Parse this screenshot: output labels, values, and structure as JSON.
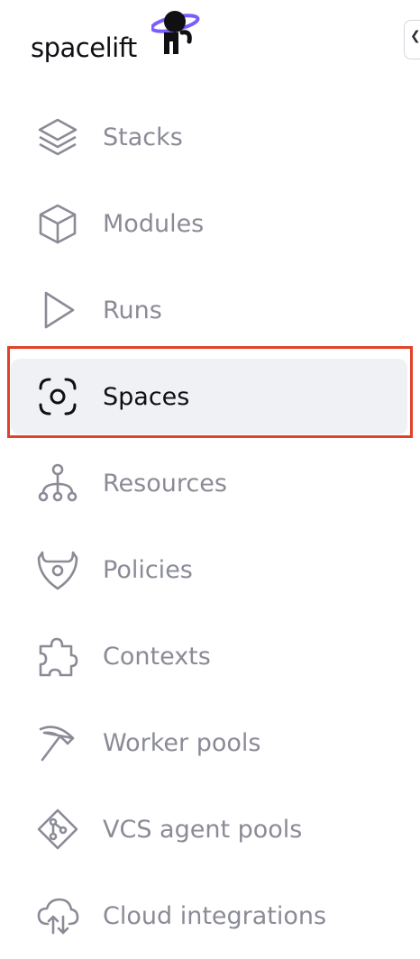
{
  "brand": {
    "name": "spacelift"
  },
  "collapse": {
    "icon": "chevron-left-icon"
  },
  "nav": {
    "items": [
      {
        "label": "Stacks",
        "icon": "stacks-icon",
        "active": false
      },
      {
        "label": "Modules",
        "icon": "modules-icon",
        "active": false
      },
      {
        "label": "Runs",
        "icon": "runs-icon",
        "active": false
      },
      {
        "label": "Spaces",
        "icon": "spaces-icon",
        "active": true
      },
      {
        "label": "Resources",
        "icon": "resources-icon",
        "active": false
      },
      {
        "label": "Policies",
        "icon": "policies-icon",
        "active": false
      },
      {
        "label": "Contexts",
        "icon": "contexts-icon",
        "active": false
      },
      {
        "label": "Worker pools",
        "icon": "worker-pools-icon",
        "active": false
      },
      {
        "label": "VCS agent pools",
        "icon": "vcs-agent-pools-icon",
        "active": false
      },
      {
        "label": "Cloud integrations",
        "icon": "cloud-integrations-icon",
        "active": false
      }
    ]
  },
  "colors": {
    "active_text": "#0f0f14",
    "inactive_text": "#8a8b96",
    "active_bg": "#f0f1f4",
    "highlight_border": "#e0412b",
    "logo_accent": "#7b5cff"
  }
}
